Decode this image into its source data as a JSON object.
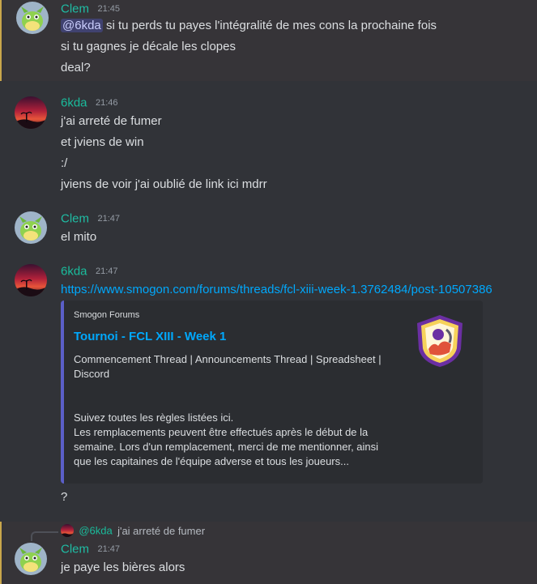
{
  "messages": [
    {
      "author": "Clem",
      "time": "21:45",
      "lines": [
        {
          "mention": "@6kda",
          "text": "si tu perds tu payes l'intégralité de mes cons la prochaine fois"
        },
        {
          "text": "si tu gagnes je décale les clopes"
        },
        {
          "text": "deal?"
        }
      ]
    },
    {
      "author": "6kda",
      "time": "21:46",
      "lines": [
        {
          "text": "j'ai arreté de fumer"
        },
        {
          "text": "et jviens de win"
        },
        {
          "text": ":/"
        },
        {
          "text": "jviens de voir j'ai oublié de link ici mdrr"
        }
      ]
    },
    {
      "author": "Clem",
      "time": "21:47",
      "lines": [
        {
          "text": "el mito"
        }
      ]
    },
    {
      "author": "6kda",
      "time": "21:47",
      "link": "https://www.smogon.com/forums/threads/fcl-xiii-week-1.3762484/post-10507386",
      "embed": {
        "provider": "Smogon Forums",
        "title": "Tournoi - FCL XIII - Week 1",
        "description_lines": [
          "Commencement Thread | Announcements Thread | Spreadsheet |",
          "Discord",
          "",
          "",
          "Suivez toutes les règles listées ici.",
          "Les remplacements peuvent être effectués après le début de la",
          "semaine. Lors d'un remplacement, merci de me mentionner, ainsi",
          "que les capitaines de l'équipe adverse et tous les joueurs..."
        ]
      },
      "after": "?"
    },
    {
      "author": "Clem",
      "time": "21:47",
      "reply": {
        "name": "@6kda",
        "text": "j'ai arreté de fumer"
      },
      "lines": [
        {
          "text": "je paye les bières alors"
        }
      ]
    }
  ],
  "colors": {
    "background": "#313338",
    "username": "#1abc9c",
    "link": "#00a8fc",
    "highlight_bar": "#c9a64b"
  },
  "icons": {
    "clem_avatar": "green-pokemon-avatar",
    "sixkda_avatar": "sunset-avatar",
    "embed_thumbnail": "smogon-logo"
  }
}
